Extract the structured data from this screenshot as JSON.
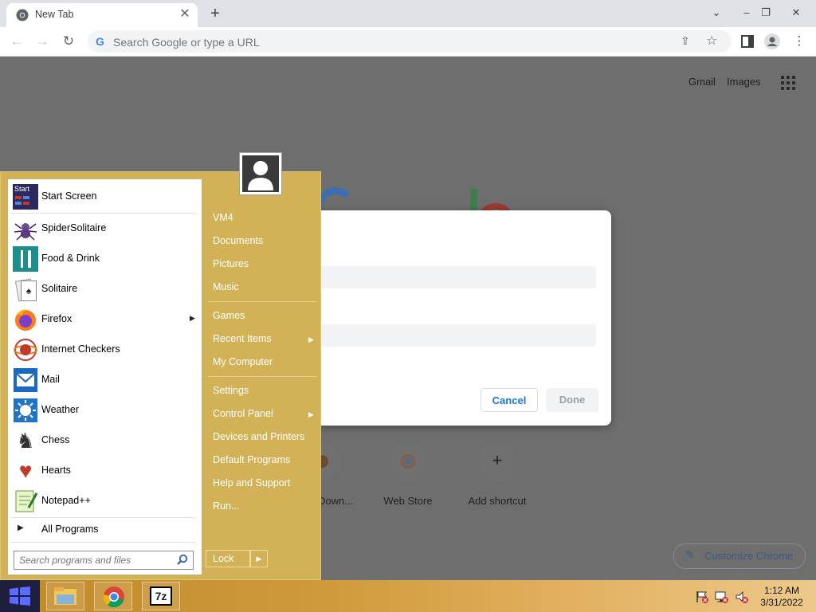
{
  "browser": {
    "tab_title": "New Tab",
    "tab_close": "✕",
    "new_tab": "+",
    "omnibox_placeholder": "Search Google or type a URL",
    "gmail": "Gmail",
    "images": "Images"
  },
  "dialog": {
    "cancel_label": "Cancel",
    "done_label": "Done"
  },
  "shortcuts": [
    {
      "label": "Down..."
    },
    {
      "label": "Web Store"
    },
    {
      "label": "Add shortcut",
      "symbol": "+"
    }
  ],
  "customize_label": "Customize Chrome",
  "start_menu": {
    "programs": [
      {
        "label": "Start Screen",
        "icon": "start-screen-icon"
      },
      {
        "label": "SpiderSolitaire",
        "icon": "spider-icon"
      },
      {
        "label": "Food & Drink",
        "icon": "fork-knife-icon"
      },
      {
        "label": "Solitaire",
        "icon": "cards-icon"
      },
      {
        "label": "Firefox",
        "icon": "firefox-icon"
      },
      {
        "label": "Internet Checkers",
        "icon": "checkers-icon"
      },
      {
        "label": "Mail",
        "icon": "mail-icon"
      },
      {
        "label": "Weather",
        "icon": "sun-icon"
      },
      {
        "label": "Chess",
        "icon": "chess-icon"
      },
      {
        "label": "Hearts",
        "icon": "heart-icon"
      },
      {
        "label": "Notepad++",
        "icon": "notepad-icon"
      }
    ],
    "start_icon_text": "Start",
    "all_programs": "All Programs",
    "search_placeholder": "Search programs and files",
    "right_items": [
      {
        "label": "VM4"
      },
      {
        "label": "Documents"
      },
      {
        "label": "Pictures"
      },
      {
        "label": "Music"
      },
      {
        "label": "Games"
      },
      {
        "label": "Recent Items"
      },
      {
        "label": "My Computer"
      },
      {
        "label": "Settings"
      },
      {
        "label": "Control Panel"
      },
      {
        "label": "Devices and Printers"
      },
      {
        "label": "Default Programs"
      },
      {
        "label": "Help and Support"
      },
      {
        "label": "Run..."
      }
    ],
    "lock_label": "Lock"
  },
  "taskbar": {
    "seven_zip_label": "7z",
    "time": "1:12 AM",
    "date": "3/31/2022"
  },
  "colors": {
    "start_menu_bg": "#d2b157",
    "chrome_blue": "#1a73e8"
  }
}
